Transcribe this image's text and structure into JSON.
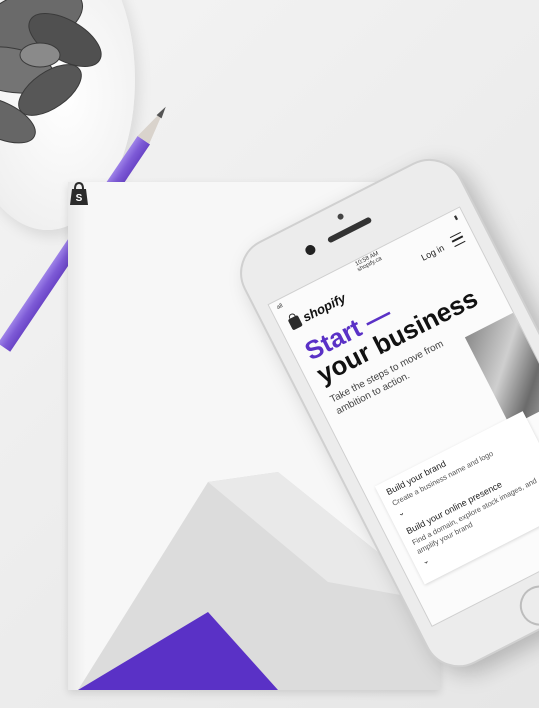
{
  "phone_screen": {
    "status": {
      "signal": "all",
      "time": "10:58 AM",
      "url": "shopify.ca"
    },
    "nav": {
      "brand": "shopify",
      "login": "Log in",
      "menu_icon": "hamburger-menu-icon"
    },
    "hero": {
      "headline_accent": "Start —",
      "headline_rest": "your business",
      "subtext": "Take the steps to move from ambition to action."
    },
    "steps": [
      {
        "title": "Build your brand",
        "desc": "Create a business name and logo",
        "icon": "chevron-down-icon"
      },
      {
        "title": "Build your online presence",
        "desc": "Find a domain, explore stock images, and amplify your brand",
        "icon": "chevron-down-icon"
      }
    ]
  },
  "colors": {
    "accent": "#5a31c6",
    "pencil": "#7d5ad6",
    "background": "#eeeeee"
  }
}
